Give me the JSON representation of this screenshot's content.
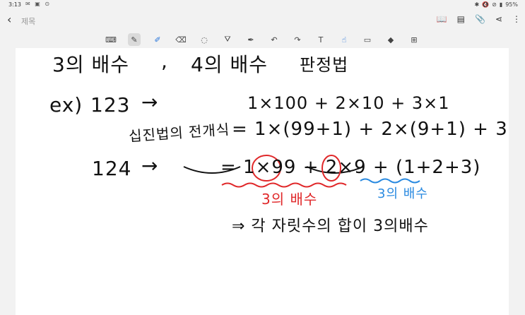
{
  "status": {
    "time": "3:13",
    "battery": "95%"
  },
  "app": {
    "title": "제목"
  },
  "note": {
    "line1_a": "3의 배수",
    "line1_sep": ",",
    "line1_b": "4의 배수",
    "line1_c": "판정법",
    "ex_label": "ex)",
    "ex_num1": "123",
    "arrow": "→",
    "expansion": "1×100 + 2×10 + 3×1",
    "decimal_label": "십진법의 전개식",
    "eq1": "= 1×(99+1) + 2×(9+1) + 3",
    "ex_num2": "124",
    "eq2": "= 1×99 + 2×9 + (1+2+3)",
    "red_label": "3의 배수",
    "blue_label": "3의 배수",
    "conclusion": "⇒ 각 자릿수의 합이 3의배수"
  },
  "colors": {
    "red": "#e0282a",
    "blue": "#2a8ae0",
    "ink": "#111111"
  }
}
